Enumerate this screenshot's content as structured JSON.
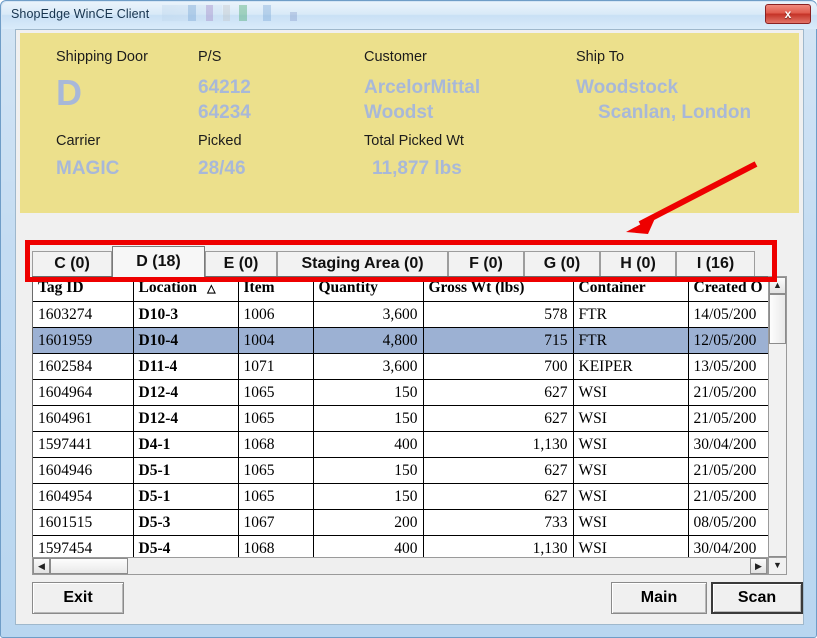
{
  "window": {
    "title": "ShopEdge WinCE Client",
    "close_label": "x"
  },
  "info_header": {
    "background_color": "#ece08c",
    "value_color": "#a8b8d8",
    "fields": [
      {
        "label": "Shipping Door",
        "value": "D"
      },
      {
        "label": "P/S",
        "value_line1": "64212",
        "value_line2": "64234"
      },
      {
        "label": "Customer",
        "value_line1": "ArcelorMittal",
        "value_line2": "Woodst"
      },
      {
        "label": "Ship To",
        "value_line1": "Woodstock",
        "value_line2": "Scanlan, London"
      },
      {
        "label": "Carrier",
        "value": "MAGIC"
      },
      {
        "label": "Picked",
        "value": "28/46"
      },
      {
        "label": "Total Picked Wt",
        "value": "11,877 lbs"
      }
    ]
  },
  "tabs": {
    "selected_index": 1,
    "items": [
      {
        "label": "C (0)"
      },
      {
        "label": "D (18)"
      },
      {
        "label": "E (0)"
      },
      {
        "label": "Staging Area (0)"
      },
      {
        "label": "F (0)"
      },
      {
        "label": "G (0)"
      },
      {
        "label": "H (0)"
      },
      {
        "label": "I (16)"
      }
    ]
  },
  "annotations": {
    "highlight_color": "#ee0000",
    "rect_target": "tab-strip",
    "arrow_target": "tab-strip"
  },
  "grid": {
    "sort_column": "Location",
    "sort_indicator": "△",
    "selected_row_index": 1,
    "selected_row_color": "#9cb1d3",
    "location_color": "#e01010",
    "columns": [
      "Tag ID",
      "Location",
      "Item",
      "Quantity",
      "Gross Wt (lbs)",
      "Container",
      "Created O"
    ],
    "rows": [
      {
        "tag_id": "1603274",
        "location": "D10-3",
        "item": "1006",
        "quantity": "3,600",
        "gross_wt": "578",
        "container": "FTR",
        "created": "14/05/200"
      },
      {
        "tag_id": "1601959",
        "location": "D10-4",
        "item": "1004",
        "quantity": "4,800",
        "gross_wt": "715",
        "container": "FTR",
        "created": "12/05/200"
      },
      {
        "tag_id": "1602584",
        "location": "D11-4",
        "item": "1071",
        "quantity": "3,600",
        "gross_wt": "700",
        "container": "KEIPER",
        "created": "13/05/200"
      },
      {
        "tag_id": "1604964",
        "location": "D12-4",
        "item": "1065",
        "quantity": "150",
        "gross_wt": "627",
        "container": "WSI",
        "created": "21/05/200"
      },
      {
        "tag_id": "1604961",
        "location": "D12-4",
        "item": "1065",
        "quantity": "150",
        "gross_wt": "627",
        "container": "WSI",
        "created": "21/05/200"
      },
      {
        "tag_id": "1597441",
        "location": "D4-1",
        "item": "1068",
        "quantity": "400",
        "gross_wt": "1,130",
        "container": "WSI",
        "created": "30/04/200"
      },
      {
        "tag_id": "1604946",
        "location": "D5-1",
        "item": "1065",
        "quantity": "150",
        "gross_wt": "627",
        "container": "WSI",
        "created": "21/05/200"
      },
      {
        "tag_id": "1604954",
        "location": "D5-1",
        "item": "1065",
        "quantity": "150",
        "gross_wt": "627",
        "container": "WSI",
        "created": "21/05/200"
      },
      {
        "tag_id": "1601515",
        "location": "D5-3",
        "item": "1067",
        "quantity": "200",
        "gross_wt": "733",
        "container": "WSI",
        "created": "08/05/200"
      },
      {
        "tag_id": "1597454",
        "location": "D5-4",
        "item": "1068",
        "quantity": "400",
        "gross_wt": "1,130",
        "container": "WSI",
        "created": "30/04/200"
      }
    ]
  },
  "scrollbars": {
    "vertical": {
      "up_glyph": "▲",
      "down_glyph": "▼"
    },
    "horizontal": {
      "left_glyph": "◀",
      "right_glyph": "▶"
    },
    "extra_glyph": "▼"
  },
  "buttons": {
    "exit": "Exit",
    "main": "Main",
    "scan": "Scan",
    "focused": "scan"
  }
}
